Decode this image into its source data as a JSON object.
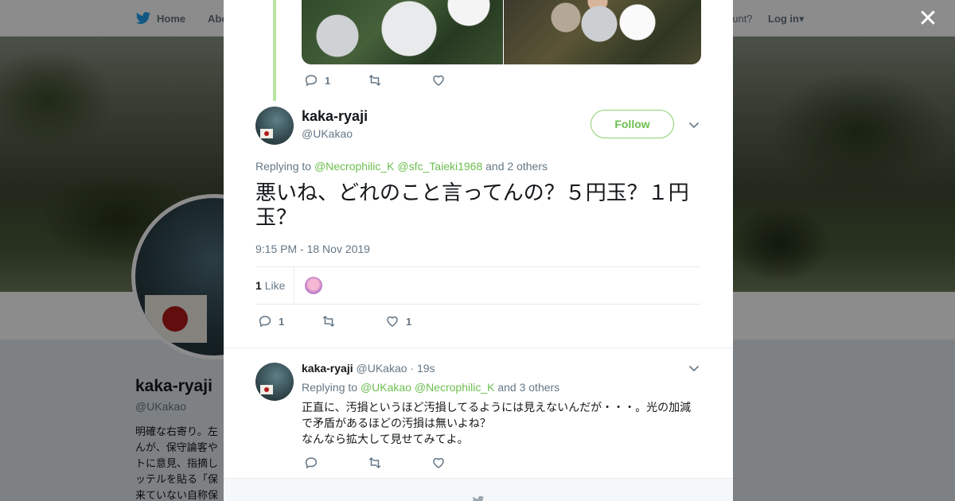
{
  "topbar": {
    "home_label": "Home",
    "about_label": "Abo",
    "account_prompt": "ccount?",
    "login_label": "Log in"
  },
  "background_profile": {
    "name": "kaka-ryaji",
    "handle": "@UKakao",
    "bio_lines": [
      "明確な右寄り。左",
      "んが、保守論客や",
      "トに意見、指摘し",
      "ッテルを貼る「保",
      "来ていない自称保"
    ]
  },
  "previous_tweet": {
    "reply_count": "1",
    "retweet_count": "",
    "like_count": ""
  },
  "main_tweet": {
    "name": "kaka-ryaji",
    "handle": "@UKakao",
    "follow_label": "Follow",
    "replying_prefix": "Replying to",
    "replying_to": [
      "@Necrophilic_K",
      "@sfc_Taieki1968"
    ],
    "replying_suffix": "and 2 others",
    "text": "悪いね、どれのこと言ってんの？５円玉？１円玉？",
    "timestamp": "9:15 PM - 18 Nov 2019",
    "like_count": "1",
    "like_word": "Like",
    "reply_count": "1",
    "retweet_count": "",
    "like_action_count": "1"
  },
  "reply_tweet": {
    "name": "kaka-ryaji",
    "handle": "@UKakao",
    "time": "19s",
    "replying_prefix": "Replying to",
    "replying_to": [
      "@UKakao",
      "@Necrophilic_K"
    ],
    "replying_suffix": "and 3 others",
    "text_lines": [
      "正直に、汚損というほど汚損してるようには見えないんだが・・・。光の加減",
      "で矛盾があるほどの汚損は無いよね？",
      "なんなら拡大して見せてみてよ。"
    ],
    "reply_count": "",
    "retweet_count": "",
    "like_count": ""
  },
  "colors": {
    "accent_green": "#6cbf4f",
    "thread_line": "#b8e3a1",
    "text_secondary": "#657786",
    "text_primary": "#14171a"
  },
  "icons": [
    "twitter-bird-icon",
    "close-icon",
    "reply-icon",
    "retweet-icon",
    "like-icon",
    "chevron-down-icon"
  ]
}
